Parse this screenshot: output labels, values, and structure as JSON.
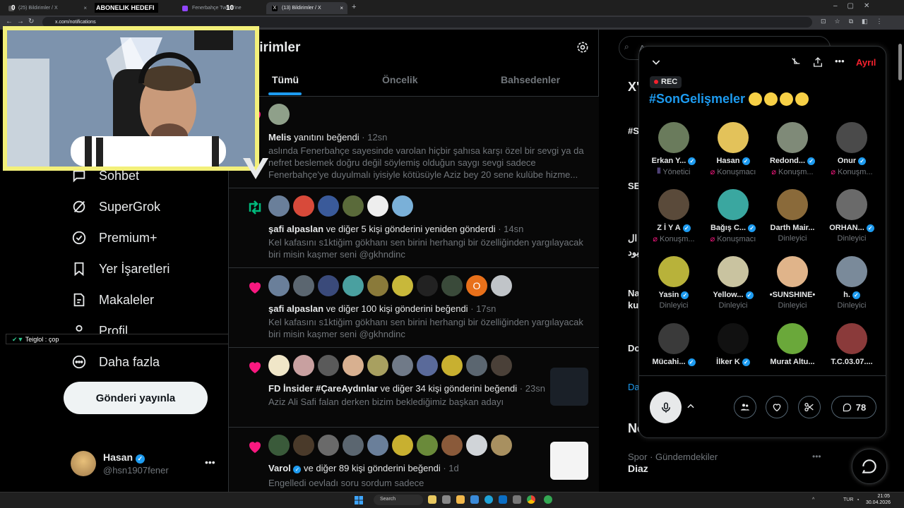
{
  "browser": {
    "tabs": [
      {
        "label": "(25) Bildirimler / X"
      },
      {
        "label": "ABONELIK HEDEFI"
      },
      {
        "label": "Fenerbahçe Twitch'ine"
      },
      {
        "label": "(13) Bildirimler / X"
      }
    ],
    "url": "x.com/notifications",
    "stream_overlay_counts": [
      "0",
      "10"
    ]
  },
  "page": {
    "title": "lirimler",
    "tabs": [
      "Tümü",
      "Öncelik",
      "Bahsedenler"
    ]
  },
  "nav": {
    "items": [
      {
        "label": "Sohbet",
        "icon": "chat-icon"
      },
      {
        "label": "SuperGrok",
        "icon": "grok-icon"
      },
      {
        "label": "Premium+",
        "icon": "premium-icon"
      },
      {
        "label": "Yer İşaretleri",
        "icon": "bookmark-icon"
      },
      {
        "label": "Makaleler",
        "icon": "article-icon"
      },
      {
        "label": "Profil",
        "icon": "profile-icon"
      },
      {
        "label": "Daha fazla",
        "icon": "more-icon"
      }
    ],
    "post_button": "Gönderi yayınla",
    "account": {
      "name": "Hasan",
      "handle": "@hsn1907fener"
    }
  },
  "chat_overlay": {
    "text": "Teiglol : çop"
  },
  "notifications": [
    {
      "actor": "Melis",
      "action": " yanıtını beğendi",
      "time": "· 12sn",
      "text": "aslında Fenerbahçe sayesinde varolan hiçbir şahısa karşı özel bir sevgi ya da nefret beslemek doğru değil söylemiş olduğun saygı sevgi sadece Fenerbahçe'ye duyulmalı iyisiyle kötüsüyle Aziz bey 20 sene kulübe hizme..."
    },
    {
      "actor": "şafi alpaslan",
      "action": " ve diğer 5 kişi gönderini yeniden gönderdi",
      "time": "· 14sn",
      "text": "Kel kafasını s1ktiğim gökhanı sen birini herhangi bir özelliğinden yargılayacak biri misin kaşmer seni @gkhndinc"
    },
    {
      "actor": "şafi alpaslan",
      "action": " ve diğer 100 kişi gönderini beğendi",
      "time": "· 17sn",
      "text": "Kel kafasını s1ktiğim gökhanı sen birini herhangi bir özelliğinden yargılayacak biri misin kaşmer seni @gkhndinc"
    },
    {
      "actor": "FD İnsider #ÇareAydınlar",
      "action": " ve diğer 34 kişi gönderini beğendi",
      "time": "· 23sn",
      "text": "Aziz Ali Safi falan derken bizim beklediğimiz başkan adayı"
    },
    {
      "actor": "Varol",
      "action": " ve diğer 89 kişi gönderini beğendi",
      "time": "· 1d",
      "text": "Engelledi oevladı soru sordum sadece"
    }
  ],
  "right": {
    "search_placeholder": "A",
    "trend_category": "Spor · Gündemdekiler",
    "trend_name": "Diaz",
    "partial": [
      "X'",
      "#S",
      "SE",
      "Na",
      "ku",
      "Do",
      "Da",
      "No",
      "ال",
      "بود"
    ]
  },
  "space": {
    "rec": "REC",
    "leave": "Ayrıl",
    "title": "#SonGelişmeler",
    "emoji_count": 4,
    "participants": [
      {
        "name": "Erkan Y...",
        "role": "Yönetici",
        "verified": true,
        "color": "#6a7b5c"
      },
      {
        "name": "Hasan",
        "role": "Konuşmacı",
        "verified": true,
        "color": "#e3c25a"
      },
      {
        "name": "Redond...",
        "role": "Konuşm...",
        "verified": true,
        "color": "#7f8a78"
      },
      {
        "name": "Onur",
        "role": "Konuşm...",
        "verified": true,
        "color": "#4a4a4a"
      },
      {
        "name": "Z İ Y A",
        "role": "Konuşm...",
        "verified": true,
        "color": "#5a4a3a"
      },
      {
        "name": "Bağış C...",
        "role": "Konuşmacı",
        "verified": true,
        "color": "#3aa7a0"
      },
      {
        "name": "Darth Mair...",
        "role": "Dinleyici",
        "verified": false,
        "color": "#8a6a3a"
      },
      {
        "name": "ORHAN...",
        "role": "Dinleyici",
        "verified": true,
        "color": "#6a6a6a"
      },
      {
        "name": "Yasin",
        "role": "Dinleyici",
        "verified": true,
        "color": "#b8b23a"
      },
      {
        "name": "Yellow...",
        "role": "Dinleyici",
        "verified": true,
        "color": "#c9c3a0"
      },
      {
        "name": "•SUNSHINE•",
        "role": "Dinleyici",
        "verified": false,
        "color": "#e0b48a"
      },
      {
        "name": "h.",
        "role": "Dinleyici",
        "verified": true,
        "color": "#7a8a9a"
      },
      {
        "name": "Mücahi...",
        "role": "",
        "verified": true,
        "color": "#3a3a3a"
      },
      {
        "name": "İlker K",
        "role": "",
        "verified": true,
        "color": "#111111"
      },
      {
        "name": "Murat Altu...",
        "role": "",
        "verified": false,
        "color": "#6aa83a"
      },
      {
        "name": "T.C.03.07....",
        "role": "",
        "verified": false,
        "color": "#8a3a3a"
      }
    ],
    "comment_count": "78"
  },
  "taskbar": {
    "search": "Search",
    "lang": "TUR",
    "time": "21:05",
    "date": "30.04.2026"
  },
  "colors": {
    "accent": "#1d9bf0",
    "like": "#f91880",
    "retweet": "#00ba7c",
    "leave": "#f4212e",
    "cam_border": "#f3f07a"
  }
}
